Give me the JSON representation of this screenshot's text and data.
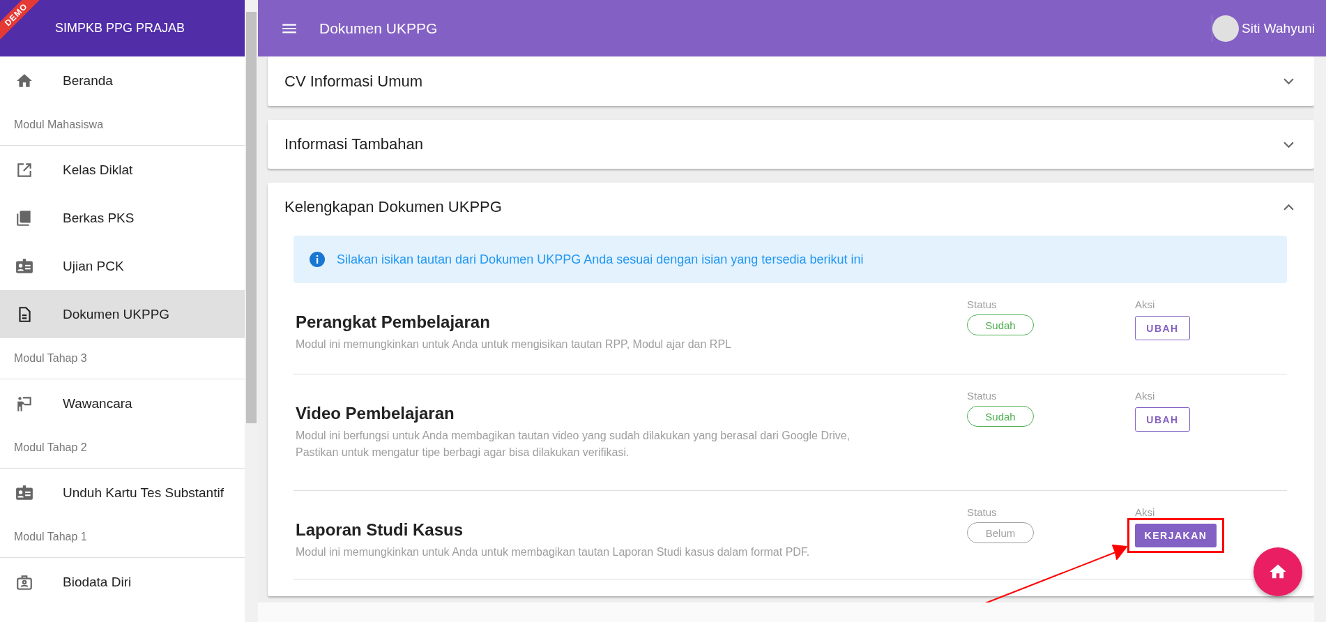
{
  "sidebar": {
    "ribbon": "DEMO",
    "title": "SIMPKB PPG PRAJAB",
    "items": [
      {
        "kind": "link",
        "label": "Beranda",
        "selected": false
      },
      {
        "kind": "section",
        "label": "Modul Mahasiswa"
      },
      {
        "kind": "link",
        "label": "Kelas Diklat",
        "selected": false
      },
      {
        "kind": "link",
        "label": "Berkas PKS",
        "selected": false
      },
      {
        "kind": "link",
        "label": "Ujian PCK",
        "selected": false
      },
      {
        "kind": "link",
        "label": "Dokumen UKPPG",
        "selected": true
      },
      {
        "kind": "section",
        "label": "Modul Tahap 3"
      },
      {
        "kind": "link",
        "label": "Wawancara",
        "selected": false
      },
      {
        "kind": "section",
        "label": "Modul Tahap 2"
      },
      {
        "kind": "link",
        "label": "Unduh Kartu Tes Substantif",
        "selected": false
      },
      {
        "kind": "section",
        "label": "Modul Tahap 1"
      },
      {
        "kind": "link",
        "label": "Biodata Diri",
        "selected": false
      }
    ]
  },
  "app_bar": {
    "title": "Dokumen UKPPG",
    "user": "Siti Wahyuni"
  },
  "panels": [
    {
      "title": "CV Informasi Umum",
      "expanded": false
    },
    {
      "title": "Informasi Tambahan",
      "expanded": false
    },
    {
      "title": "Kelengkapan Dokumen UKPPG",
      "expanded": true,
      "alert": "Silakan isikan tautan dari Dokumen UKPPG Anda sesuai dengan isian yang tersedia berikut ini",
      "rows": [
        {
          "title": "Perangkat Pembelajaran",
          "description": [
            "Modul ini memungkinkan untuk Anda untuk mengisikan tautan RPP, Modul ajar dan RPL"
          ],
          "status_label": "Status",
          "status": "Sudah",
          "done": true,
          "action_label": "Aksi",
          "action": "UBAH",
          "kind": "outlined",
          "highlighted": false
        },
        {
          "title": "Video Pembelajaran",
          "description": [
            "Modul ini berfungsi untuk Anda membagikan tautan video yang sudah dilakukan yang berasal dari Google Drive,",
            "Pastikan untuk mengatur tipe berbagi agar bisa dilakukan verifikasi."
          ],
          "status_label": "Status",
          "status": "Sudah",
          "done": true,
          "action_label": "Aksi",
          "action": "UBAH",
          "kind": "outlined",
          "highlighted": false
        },
        {
          "title": "Laporan Studi Kasus",
          "description": [
            "Modul ini memungkinkan untuk Anda untuk membagikan tautan Laporan Studi kasus dalam format PDF."
          ],
          "status_label": "Status",
          "status": "Belum",
          "done": false,
          "action_label": "Aksi",
          "action": "KERJAKAN",
          "kind": "filled",
          "highlighted": true
        }
      ]
    }
  ]
}
